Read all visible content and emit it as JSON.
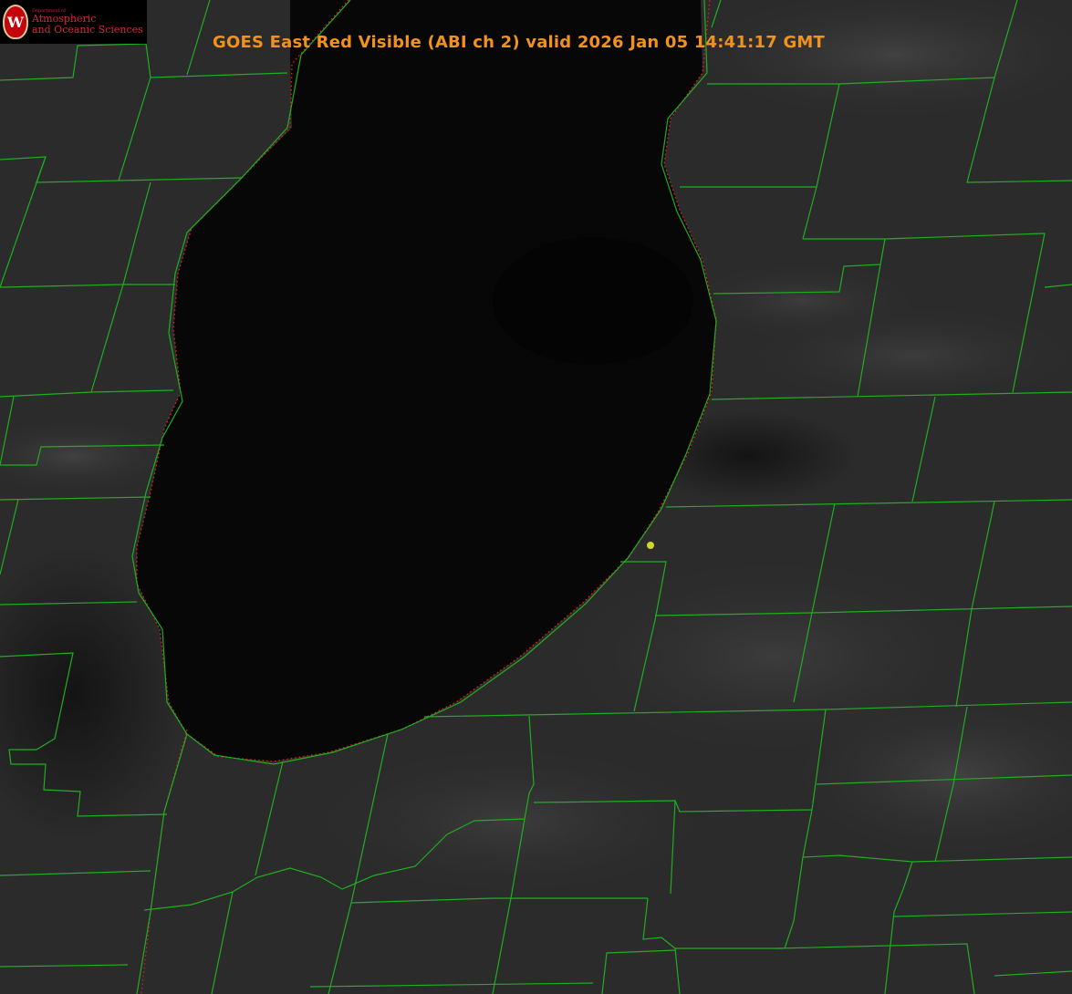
{
  "logo": {
    "crest_letter": "W",
    "line_small": "Department of",
    "line1": "Atmospheric",
    "line2": "and Oceanic Sciences"
  },
  "title": "GOES East Red Visible (ABI ch 2) valid 2026 Jan 05 14:41:17 GMT",
  "colors": {
    "title": "#f0921c",
    "county_lines": "#1fae1f",
    "shoreline_dotted": "#e02020",
    "point_marker": "#d4d42a",
    "lake_fill": "#070707"
  },
  "icons": {
    "logo": "uw-crest-icon",
    "marker": "yellow-dot-marker"
  }
}
